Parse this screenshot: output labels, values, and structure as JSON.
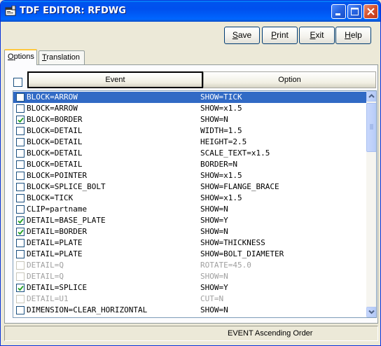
{
  "window": {
    "title": "TDF EDITOR: RFDWG"
  },
  "toolbar": {
    "save": {
      "accel": "S",
      "rest": "ave"
    },
    "print": {
      "accel": "P",
      "rest": "rint"
    },
    "exit": {
      "accel": "E",
      "rest": "xit"
    },
    "help": {
      "accel": "H",
      "rest": "elp"
    }
  },
  "tabs": [
    {
      "accel": "O",
      "rest": "ptions",
      "active": true
    },
    {
      "accel": "T",
      "rest": "ranslation",
      "active": false
    }
  ],
  "columns": {
    "event": "Event",
    "option": "Option"
  },
  "rows": [
    {
      "event": "BLOCK=ARROW",
      "option": "SHOW=TICK",
      "checked": false,
      "selected": true,
      "disabled": false
    },
    {
      "event": "BLOCK=ARROW",
      "option": "SHOW=x1.5",
      "checked": false,
      "selected": false,
      "disabled": false
    },
    {
      "event": "BLOCK=BORDER",
      "option": "SHOW=N",
      "checked": true,
      "selected": false,
      "disabled": false
    },
    {
      "event": "BLOCK=DETAIL",
      "option": "WIDTH=1.5",
      "checked": false,
      "selected": false,
      "disabled": false
    },
    {
      "event": "BLOCK=DETAIL",
      "option": "HEIGHT=2.5",
      "checked": false,
      "selected": false,
      "disabled": false
    },
    {
      "event": "BLOCK=DETAIL",
      "option": "SCALE_TEXT=x1.5",
      "checked": false,
      "selected": false,
      "disabled": false
    },
    {
      "event": "BLOCK=DETAIL",
      "option": "BORDER=N",
      "checked": false,
      "selected": false,
      "disabled": false
    },
    {
      "event": "BLOCK=POINTER",
      "option": "SHOW=x1.5",
      "checked": false,
      "selected": false,
      "disabled": false
    },
    {
      "event": "BLOCK=SPLICE_BOLT",
      "option": "SHOW=FLANGE_BRACE",
      "checked": false,
      "selected": false,
      "disabled": false
    },
    {
      "event": "BLOCK=TICK",
      "option": "SHOW=x1.5",
      "checked": false,
      "selected": false,
      "disabled": false
    },
    {
      "event": "CLIP=partname",
      "option": "SHOW=N",
      "checked": false,
      "selected": false,
      "disabled": false
    },
    {
      "event": "DETAIL=BASE_PLATE",
      "option": "SHOW=Y",
      "checked": true,
      "selected": false,
      "disabled": false
    },
    {
      "event": "DETAIL=BORDER",
      "option": "SHOW=N",
      "checked": true,
      "selected": false,
      "disabled": false
    },
    {
      "event": "DETAIL=PLATE",
      "option": "SHOW=THICKNESS",
      "checked": false,
      "selected": false,
      "disabled": false
    },
    {
      "event": "DETAIL=PLATE",
      "option": "SHOW=BOLT_DIAMETER",
      "checked": false,
      "selected": false,
      "disabled": false
    },
    {
      "event": "DETAIL=Q",
      "option": "ROTATE=45.0",
      "checked": false,
      "selected": false,
      "disabled": true
    },
    {
      "event": "DETAIL=Q",
      "option": "SHOW=N",
      "checked": false,
      "selected": false,
      "disabled": true
    },
    {
      "event": "DETAIL=SPLICE",
      "option": "SHOW=Y",
      "checked": true,
      "selected": false,
      "disabled": false
    },
    {
      "event": "DETAIL=U1",
      "option": "CUT=N",
      "checked": false,
      "selected": false,
      "disabled": true
    },
    {
      "event": "DIMENSION=CLEAR_HORIZONTAL",
      "option": "SHOW=N",
      "checked": false,
      "selected": false,
      "disabled": false
    }
  ],
  "status": {
    "text": "EVENT Ascending Order"
  },
  "colors": {
    "selection": "#316ac5",
    "titlebar": "#0054e3",
    "disabled_text": "#a0a0a0"
  }
}
